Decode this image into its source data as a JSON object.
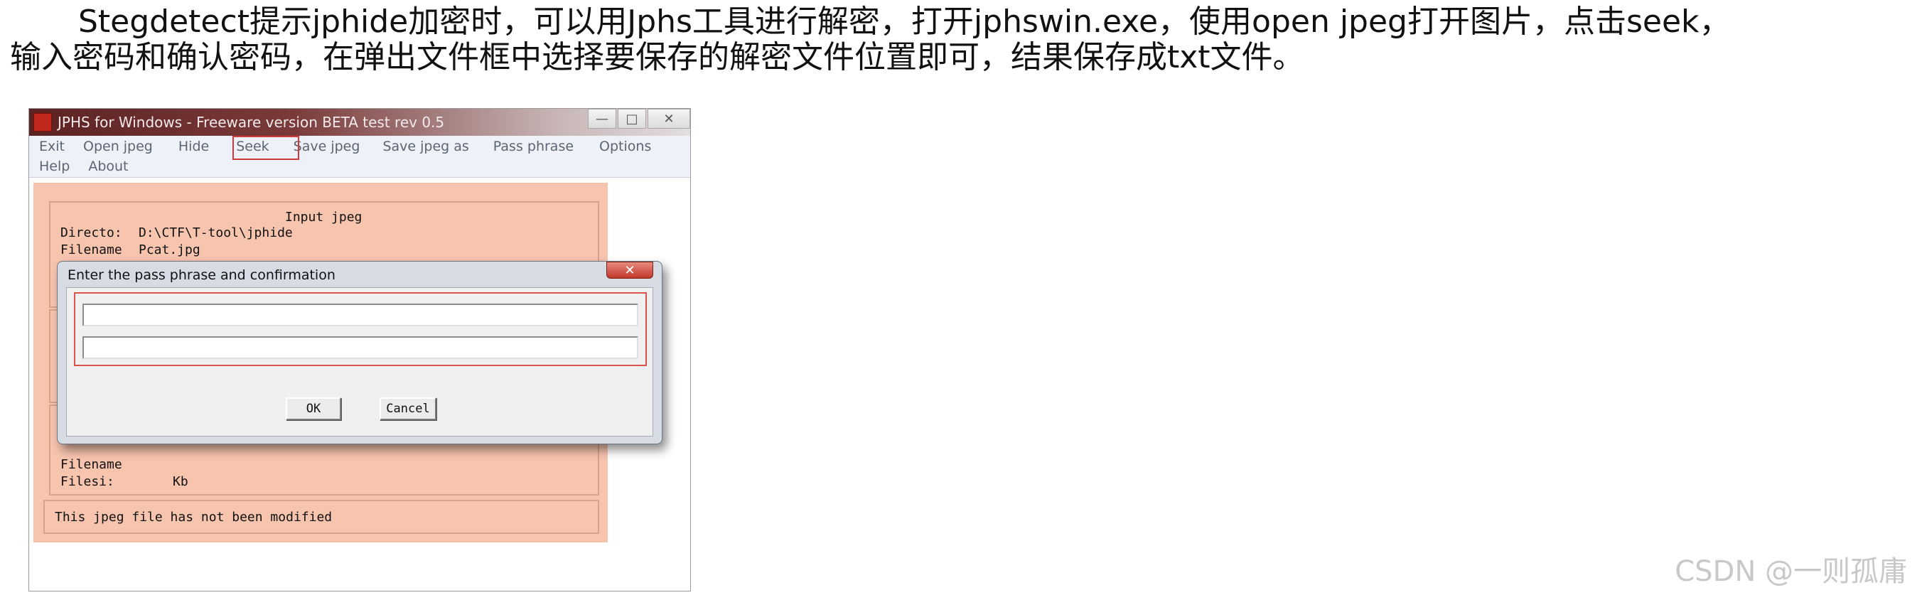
{
  "caption": {
    "line1": "Stegdetect提示jphide加密时，可以用Jphs工具进行解密，打开jphswin.exe，使用open jpeg打开图片，点击seek，",
    "line2": "输入密码和确认密码，在弹出文件框中选择要保存的解密文件位置即可，结果保存成txt文件。"
  },
  "window": {
    "title": "JPHS for Windows - Freeware version BETA test rev 0.5",
    "controls": {
      "minimize": "—",
      "maximize": "□",
      "close": "✕"
    },
    "menu_row1": [
      "Exit",
      "Open jpeg",
      "Hide",
      "Seek",
      "Save jpeg",
      "Save jpeg as",
      "Pass phrase",
      "Options"
    ],
    "menu_row2": [
      "Help",
      "About"
    ],
    "input_group": {
      "title": "Input jpeg",
      "directory_label": "Directo:",
      "directory_value": "D:\\CTF\\T-tool\\jphide",
      "filename_label": "Filename",
      "filename_value": "Pcat.jpg"
    },
    "output_group": {
      "filename_label": "Filename",
      "filesize_label": "Filesi:",
      "filesize_unit": "Kb"
    },
    "status_text": "This jpeg file has not been modified"
  },
  "dialog": {
    "title": "Enter the pass phrase and confirmation",
    "close": "✕",
    "passphrase_value": "",
    "confirmation_value": "",
    "ok_label": "OK",
    "cancel_label": "Cancel"
  },
  "watermark": "CSDN @一则孤庸"
}
